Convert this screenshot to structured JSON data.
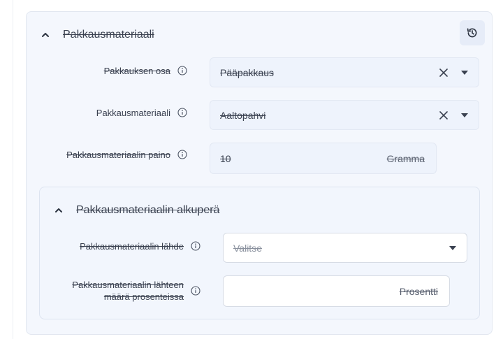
{
  "section": {
    "title": "Pakkausmateriaali",
    "history_icon": "history-icon"
  },
  "rows": {
    "part": {
      "label": "Pakkauksen osa",
      "value": "Pääpakkaus"
    },
    "material": {
      "label": "Pakkausmateriaali",
      "value": "Aaltopahvi"
    },
    "weight": {
      "label": "Pakkausmateriaalin paino",
      "value": "10",
      "unit": "Gramma"
    }
  },
  "origin": {
    "title": "Pakkausmateriaalin alkuperä",
    "source": {
      "label": "Pakkausmateriaalin lähde",
      "placeholder": "Valitse"
    },
    "share": {
      "label_line1": "Pakkausmateriaalin lähteen",
      "label_line2": "määrä prosenteissa",
      "unit": "Prosentti"
    }
  },
  "colors": {
    "card_bg": "#f4f7fd",
    "field_bg": "#eef3fc",
    "text": "#3a4150"
  }
}
